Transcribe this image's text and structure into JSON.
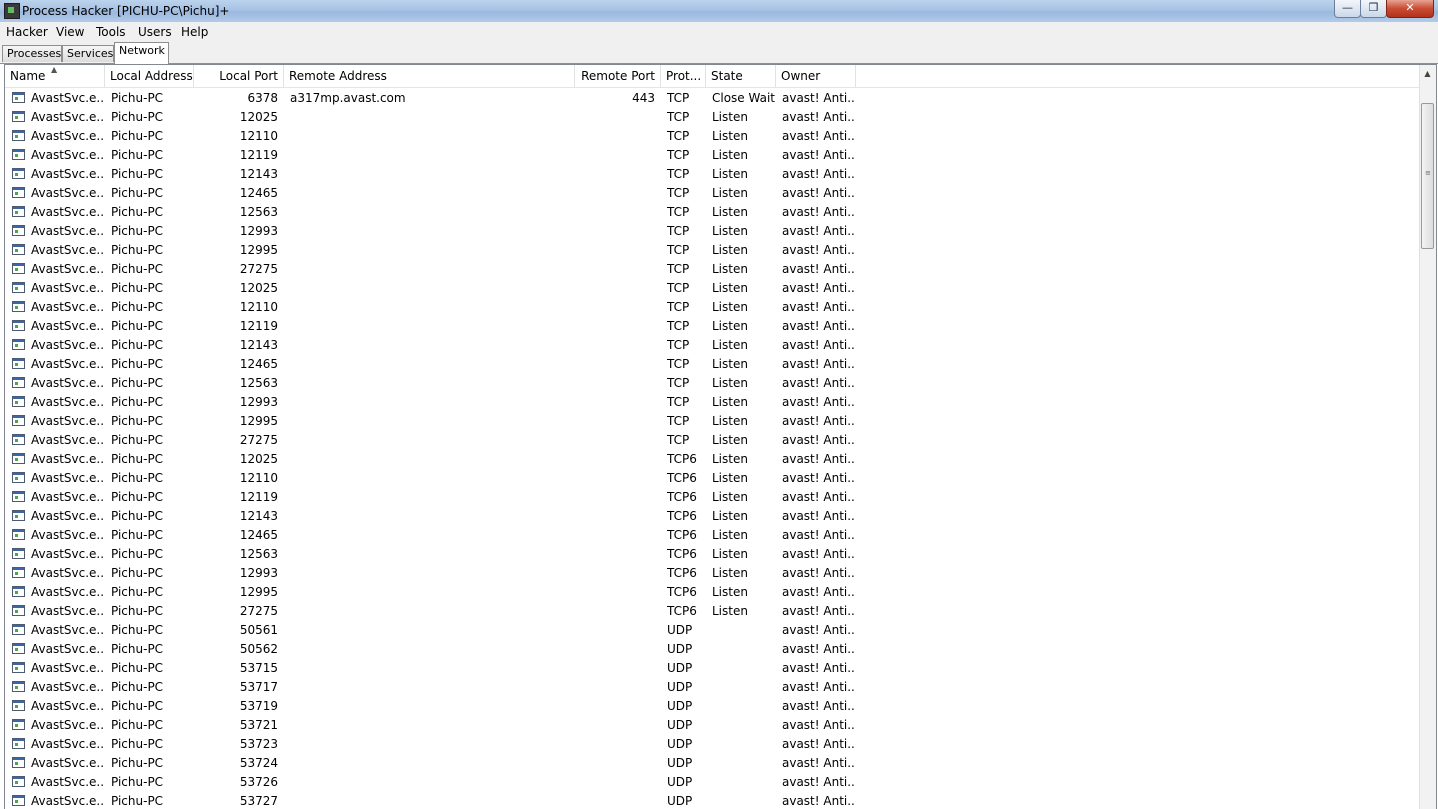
{
  "window": {
    "title": "Process Hacker [PICHU-PC\\Pichu]+",
    "minimize_glyph": "—",
    "maximize_glyph": "❐",
    "close_glyph": "✕"
  },
  "menu": [
    "Hacker",
    "View",
    "Tools",
    "Users",
    "Help"
  ],
  "tabs": [
    "Processes",
    "Services",
    "Network"
  ],
  "active_tab": "Network",
  "columns": [
    "Name",
    "Local Address",
    "Local Port",
    "Remote Address",
    "Remote Port",
    "Prot...",
    "State",
    "Owner"
  ],
  "rows": [
    {
      "name": "AvastSvc.e...",
      "local_address": "Pichu-PC",
      "local_port": "6378",
      "remote_address": "a317mp.avast.com",
      "remote_port": "443",
      "protocol": "TCP",
      "state": "Close Wait",
      "owner": "avast! Anti..."
    },
    {
      "name": "AvastSvc.e...",
      "local_address": "Pichu-PC",
      "local_port": "12025",
      "remote_address": "",
      "remote_port": "",
      "protocol": "TCP",
      "state": "Listen",
      "owner": "avast! Anti..."
    },
    {
      "name": "AvastSvc.e...",
      "local_address": "Pichu-PC",
      "local_port": "12110",
      "remote_address": "",
      "remote_port": "",
      "protocol": "TCP",
      "state": "Listen",
      "owner": "avast! Anti..."
    },
    {
      "name": "AvastSvc.e...",
      "local_address": "Pichu-PC",
      "local_port": "12119",
      "remote_address": "",
      "remote_port": "",
      "protocol": "TCP",
      "state": "Listen",
      "owner": "avast! Anti..."
    },
    {
      "name": "AvastSvc.e...",
      "local_address": "Pichu-PC",
      "local_port": "12143",
      "remote_address": "",
      "remote_port": "",
      "protocol": "TCP",
      "state": "Listen",
      "owner": "avast! Anti..."
    },
    {
      "name": "AvastSvc.e...",
      "local_address": "Pichu-PC",
      "local_port": "12465",
      "remote_address": "",
      "remote_port": "",
      "protocol": "TCP",
      "state": "Listen",
      "owner": "avast! Anti..."
    },
    {
      "name": "AvastSvc.e...",
      "local_address": "Pichu-PC",
      "local_port": "12563",
      "remote_address": "",
      "remote_port": "",
      "protocol": "TCP",
      "state": "Listen",
      "owner": "avast! Anti..."
    },
    {
      "name": "AvastSvc.e...",
      "local_address": "Pichu-PC",
      "local_port": "12993",
      "remote_address": "",
      "remote_port": "",
      "protocol": "TCP",
      "state": "Listen",
      "owner": "avast! Anti..."
    },
    {
      "name": "AvastSvc.e...",
      "local_address": "Pichu-PC",
      "local_port": "12995",
      "remote_address": "",
      "remote_port": "",
      "protocol": "TCP",
      "state": "Listen",
      "owner": "avast! Anti..."
    },
    {
      "name": "AvastSvc.e...",
      "local_address": "Pichu-PC",
      "local_port": "27275",
      "remote_address": "",
      "remote_port": "",
      "protocol": "TCP",
      "state": "Listen",
      "owner": "avast! Anti..."
    },
    {
      "name": "AvastSvc.e...",
      "local_address": "Pichu-PC",
      "local_port": "12025",
      "remote_address": "",
      "remote_port": "",
      "protocol": "TCP",
      "state": "Listen",
      "owner": "avast! Anti..."
    },
    {
      "name": "AvastSvc.e...",
      "local_address": "Pichu-PC",
      "local_port": "12110",
      "remote_address": "",
      "remote_port": "",
      "protocol": "TCP",
      "state": "Listen",
      "owner": "avast! Anti..."
    },
    {
      "name": "AvastSvc.e...",
      "local_address": "Pichu-PC",
      "local_port": "12119",
      "remote_address": "",
      "remote_port": "",
      "protocol": "TCP",
      "state": "Listen",
      "owner": "avast! Anti..."
    },
    {
      "name": "AvastSvc.e...",
      "local_address": "Pichu-PC",
      "local_port": "12143",
      "remote_address": "",
      "remote_port": "",
      "protocol": "TCP",
      "state": "Listen",
      "owner": "avast! Anti..."
    },
    {
      "name": "AvastSvc.e...",
      "local_address": "Pichu-PC",
      "local_port": "12465",
      "remote_address": "",
      "remote_port": "",
      "protocol": "TCP",
      "state": "Listen",
      "owner": "avast! Anti..."
    },
    {
      "name": "AvastSvc.e...",
      "local_address": "Pichu-PC",
      "local_port": "12563",
      "remote_address": "",
      "remote_port": "",
      "protocol": "TCP",
      "state": "Listen",
      "owner": "avast! Anti..."
    },
    {
      "name": "AvastSvc.e...",
      "local_address": "Pichu-PC",
      "local_port": "12993",
      "remote_address": "",
      "remote_port": "",
      "protocol": "TCP",
      "state": "Listen",
      "owner": "avast! Anti..."
    },
    {
      "name": "AvastSvc.e...",
      "local_address": "Pichu-PC",
      "local_port": "12995",
      "remote_address": "",
      "remote_port": "",
      "protocol": "TCP",
      "state": "Listen",
      "owner": "avast! Anti..."
    },
    {
      "name": "AvastSvc.e...",
      "local_address": "Pichu-PC",
      "local_port": "27275",
      "remote_address": "",
      "remote_port": "",
      "protocol": "TCP",
      "state": "Listen",
      "owner": "avast! Anti..."
    },
    {
      "name": "AvastSvc.e...",
      "local_address": "Pichu-PC",
      "local_port": "12025",
      "remote_address": "",
      "remote_port": "",
      "protocol": "TCP6",
      "state": "Listen",
      "owner": "avast! Anti..."
    },
    {
      "name": "AvastSvc.e...",
      "local_address": "Pichu-PC",
      "local_port": "12110",
      "remote_address": "",
      "remote_port": "",
      "protocol": "TCP6",
      "state": "Listen",
      "owner": "avast! Anti..."
    },
    {
      "name": "AvastSvc.e...",
      "local_address": "Pichu-PC",
      "local_port": "12119",
      "remote_address": "",
      "remote_port": "",
      "protocol": "TCP6",
      "state": "Listen",
      "owner": "avast! Anti..."
    },
    {
      "name": "AvastSvc.e...",
      "local_address": "Pichu-PC",
      "local_port": "12143",
      "remote_address": "",
      "remote_port": "",
      "protocol": "TCP6",
      "state": "Listen",
      "owner": "avast! Anti..."
    },
    {
      "name": "AvastSvc.e...",
      "local_address": "Pichu-PC",
      "local_port": "12465",
      "remote_address": "",
      "remote_port": "",
      "protocol": "TCP6",
      "state": "Listen",
      "owner": "avast! Anti..."
    },
    {
      "name": "AvastSvc.e...",
      "local_address": "Pichu-PC",
      "local_port": "12563",
      "remote_address": "",
      "remote_port": "",
      "protocol": "TCP6",
      "state": "Listen",
      "owner": "avast! Anti..."
    },
    {
      "name": "AvastSvc.e...",
      "local_address": "Pichu-PC",
      "local_port": "12993",
      "remote_address": "",
      "remote_port": "",
      "protocol": "TCP6",
      "state": "Listen",
      "owner": "avast! Anti..."
    },
    {
      "name": "AvastSvc.e...",
      "local_address": "Pichu-PC",
      "local_port": "12995",
      "remote_address": "",
      "remote_port": "",
      "protocol": "TCP6",
      "state": "Listen",
      "owner": "avast! Anti..."
    },
    {
      "name": "AvastSvc.e...",
      "local_address": "Pichu-PC",
      "local_port": "27275",
      "remote_address": "",
      "remote_port": "",
      "protocol": "TCP6",
      "state": "Listen",
      "owner": "avast! Anti..."
    },
    {
      "name": "AvastSvc.e...",
      "local_address": "Pichu-PC",
      "local_port": "50561",
      "remote_address": "",
      "remote_port": "",
      "protocol": "UDP",
      "state": "",
      "owner": "avast! Anti..."
    },
    {
      "name": "AvastSvc.e...",
      "local_address": "Pichu-PC",
      "local_port": "50562",
      "remote_address": "",
      "remote_port": "",
      "protocol": "UDP",
      "state": "",
      "owner": "avast! Anti..."
    },
    {
      "name": "AvastSvc.e...",
      "local_address": "Pichu-PC",
      "local_port": "53715",
      "remote_address": "",
      "remote_port": "",
      "protocol": "UDP",
      "state": "",
      "owner": "avast! Anti..."
    },
    {
      "name": "AvastSvc.e...",
      "local_address": "Pichu-PC",
      "local_port": "53717",
      "remote_address": "",
      "remote_port": "",
      "protocol": "UDP",
      "state": "",
      "owner": "avast! Anti..."
    },
    {
      "name": "AvastSvc.e...",
      "local_address": "Pichu-PC",
      "local_port": "53719",
      "remote_address": "",
      "remote_port": "",
      "protocol": "UDP",
      "state": "",
      "owner": "avast! Anti..."
    },
    {
      "name": "AvastSvc.e...",
      "local_address": "Pichu-PC",
      "local_port": "53721",
      "remote_address": "",
      "remote_port": "",
      "protocol": "UDP",
      "state": "",
      "owner": "avast! Anti..."
    },
    {
      "name": "AvastSvc.e...",
      "local_address": "Pichu-PC",
      "local_port": "53723",
      "remote_address": "",
      "remote_port": "",
      "protocol": "UDP",
      "state": "",
      "owner": "avast! Anti..."
    },
    {
      "name": "AvastSvc.e...",
      "local_address": "Pichu-PC",
      "local_port": "53724",
      "remote_address": "",
      "remote_port": "",
      "protocol": "UDP",
      "state": "",
      "owner": "avast! Anti..."
    },
    {
      "name": "AvastSvc.e...",
      "local_address": "Pichu-PC",
      "local_port": "53726",
      "remote_address": "",
      "remote_port": "",
      "protocol": "UDP",
      "state": "",
      "owner": "avast! Anti..."
    },
    {
      "name": "AvastSvc.e...",
      "local_address": "Pichu-PC",
      "local_port": "53727",
      "remote_address": "",
      "remote_port": "",
      "protocol": "UDP",
      "state": "",
      "owner": "avast! Anti..."
    }
  ],
  "icons": {
    "app": "process-hacker-icon",
    "row": "process-window-icon",
    "sort": "sort-ascending-icon"
  }
}
